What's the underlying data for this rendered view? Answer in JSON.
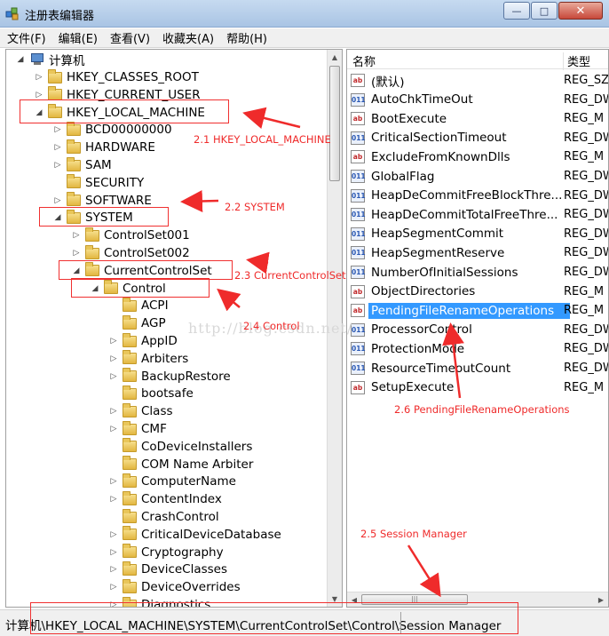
{
  "window": {
    "title": "注册表编辑器",
    "buttons": {
      "minimize": "—",
      "maximize": "□",
      "close": "✕"
    }
  },
  "menu": [
    "文件(F)",
    "编辑(E)",
    "查看(V)",
    "收藏夹(A)",
    "帮助(H)"
  ],
  "tree": {
    "root": "计算机",
    "items": [
      {
        "label": "HKEY_CLASSES_ROOT",
        "state": "collapsed"
      },
      {
        "label": "HKEY_CURRENT_USER",
        "state": "collapsed"
      },
      {
        "label": "HKEY_LOCAL_MACHINE",
        "state": "expanded"
      },
      {
        "label": "BCD00000000",
        "state": "collapsed"
      },
      {
        "label": "HARDWARE",
        "state": "collapsed"
      },
      {
        "label": "SAM",
        "state": "collapsed"
      },
      {
        "label": "SECURITY",
        "state": "none"
      },
      {
        "label": "SOFTWARE",
        "state": "collapsed"
      },
      {
        "label": "SYSTEM",
        "state": "expanded"
      },
      {
        "label": "ControlSet001",
        "state": "collapsed"
      },
      {
        "label": "ControlSet002",
        "state": "collapsed"
      },
      {
        "label": "CurrentControlSet",
        "state": "expanded"
      },
      {
        "label": "Control",
        "state": "expanded"
      },
      {
        "label": "ACPI",
        "state": "none"
      },
      {
        "label": "AGP",
        "state": "none"
      },
      {
        "label": "AppID",
        "state": "collapsed"
      },
      {
        "label": "Arbiters",
        "state": "collapsed"
      },
      {
        "label": "BackupRestore",
        "state": "collapsed"
      },
      {
        "label": "bootsafe",
        "state": "none"
      },
      {
        "label": "Class",
        "state": "collapsed"
      },
      {
        "label": "CMF",
        "state": "collapsed"
      },
      {
        "label": "CoDeviceInstallers",
        "state": "none"
      },
      {
        "label": "COM Name Arbiter",
        "state": "none"
      },
      {
        "label": "ComputerName",
        "state": "collapsed"
      },
      {
        "label": "ContentIndex",
        "state": "collapsed"
      },
      {
        "label": "CrashControl",
        "state": "none"
      },
      {
        "label": "CriticalDeviceDatabase",
        "state": "collapsed"
      },
      {
        "label": "Cryptography",
        "state": "collapsed"
      },
      {
        "label": "DeviceClasses",
        "state": "collapsed"
      },
      {
        "label": "DeviceOverrides",
        "state": "collapsed"
      },
      {
        "label": "Diagnostics",
        "state": "collapsed"
      }
    ]
  },
  "list": {
    "columns": {
      "name": "名称",
      "type": "类型"
    },
    "rows": [
      {
        "icon": "string",
        "name": "(默认)",
        "type": "REG_SZ"
      },
      {
        "icon": "binary",
        "name": "AutoChkTimeOut",
        "type": "REG_DW"
      },
      {
        "icon": "string",
        "name": "BootExecute",
        "type": "REG_M"
      },
      {
        "icon": "binary",
        "name": "CriticalSectionTimeout",
        "type": "REG_DW"
      },
      {
        "icon": "string",
        "name": "ExcludeFromKnownDlls",
        "type": "REG_M"
      },
      {
        "icon": "binary",
        "name": "GlobalFlag",
        "type": "REG_DW"
      },
      {
        "icon": "binary",
        "name": "HeapDeCommitFreeBlockThre...",
        "type": "REG_DW"
      },
      {
        "icon": "binary",
        "name": "HeapDeCommitTotalFreeThre...",
        "type": "REG_DW"
      },
      {
        "icon": "binary",
        "name": "HeapSegmentCommit",
        "type": "REG_DW"
      },
      {
        "icon": "binary",
        "name": "HeapSegmentReserve",
        "type": "REG_DW"
      },
      {
        "icon": "binary",
        "name": "NumberOfInitialSessions",
        "type": "REG_DW"
      },
      {
        "icon": "string",
        "name": "ObjectDirectories",
        "type": "REG_M"
      },
      {
        "icon": "string",
        "name": "PendingFileRenameOperations",
        "type": "REG_M",
        "selected": true
      },
      {
        "icon": "binary",
        "name": "ProcessorControl",
        "type": "REG_DW"
      },
      {
        "icon": "binary",
        "name": "ProtectionMode",
        "type": "REG_DW"
      },
      {
        "icon": "binary",
        "name": "ResourceTimeoutCount",
        "type": "REG_DW"
      },
      {
        "icon": "string",
        "name": "SetupExecute",
        "type": "REG_M"
      }
    ]
  },
  "status": {
    "path": "计算机\\HKEY_LOCAL_MACHINE\\SYSTEM\\CurrentControlSet\\Control\\Session Manager"
  },
  "annotations": {
    "a1": "2.1 HKEY_LOCAL_MACHINE",
    "a2": "2.2 SYSTEM",
    "a3": "2.3 CurrentControlSet",
    "a4": "2.4 Control",
    "a5": "2.5 Session Manager",
    "a6": "2.6 PendingFileRenameOperations"
  },
  "watermark": "http://blog.csdn.net/",
  "colors": {
    "annotation": "#ef2b2b",
    "selection": "#3399ff"
  }
}
